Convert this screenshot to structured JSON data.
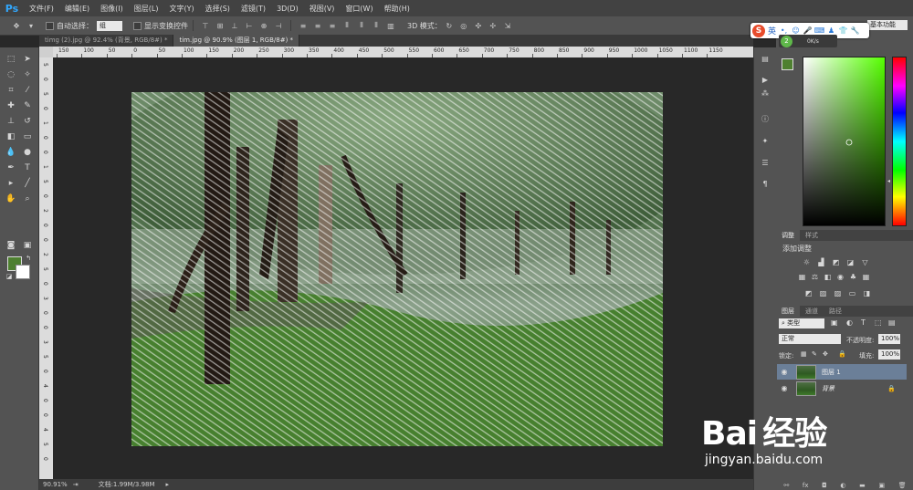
{
  "app": {
    "logo": "Ps"
  },
  "menu": [
    "文件(F)",
    "编辑(E)",
    "图像(I)",
    "图层(L)",
    "文字(Y)",
    "选择(S)",
    "滤镜(T)",
    "3D(D)",
    "视图(V)",
    "窗口(W)",
    "帮助(H)"
  ],
  "options": {
    "auto_select_label": "自动选择：",
    "auto_select_value": "组",
    "show_transform_label": "显示变换控件",
    "mode_3d_label": "3D 模式：",
    "workspace_value": "基本功能"
  },
  "tabs": [
    {
      "label": "timg (2).jpg @ 92.4% (背景, RGB/8#) *",
      "active": false
    },
    {
      "label": "tim.jpg @ 90.9% (图层 1, RGB/8#) *",
      "active": true
    }
  ],
  "ruler": {
    "h_ticks": [
      "150",
      "100",
      "50",
      "0",
      "50",
      "100",
      "150",
      "200",
      "250",
      "300",
      "350",
      "400",
      "450",
      "500",
      "550",
      "600",
      "650",
      "700",
      "750",
      "800",
      "850",
      "900",
      "950",
      "1000",
      "1050",
      "1100",
      "1150"
    ],
    "v_ticks": [
      "5",
      "0",
      "5",
      "0",
      "1",
      "0",
      "0",
      "1",
      "5",
      "0",
      "2",
      "0",
      "0",
      "2",
      "5",
      "0",
      "3",
      "0",
      "0",
      "3",
      "5",
      "0",
      "4",
      "0",
      "0",
      "4",
      "5",
      "0"
    ]
  },
  "status": {
    "zoom": "90.91%",
    "doc_info": "文档:1.99M/3.98M"
  },
  "ime": {
    "language": "英",
    "net_speed": "0K/s",
    "net_percent": "2"
  },
  "panels": {
    "color_tabs": [
      "颜色",
      "色板"
    ],
    "adjust_tabs": [
      "调整",
      "样式"
    ],
    "adjust_title": "添加调整",
    "layers_tabs": [
      "图层",
      "通道",
      "路径"
    ],
    "filter_type": "类型",
    "blend_mode": "正常",
    "opacity_label": "不透明度:",
    "opacity_value": "100%",
    "lock_label": "锁定:",
    "fill_label": "填充:",
    "fill_value": "100%",
    "layers": [
      {
        "name": "图层 1",
        "selected": true
      },
      {
        "name": "背景",
        "selected": false
      }
    ]
  },
  "colors": {
    "foreground": "#4e8030",
    "background": "#ffffff",
    "accent_selected_layer": "#6b7f98"
  },
  "watermark": {
    "brand": "Bai 经验",
    "url": "jingyan.baidu.com"
  }
}
